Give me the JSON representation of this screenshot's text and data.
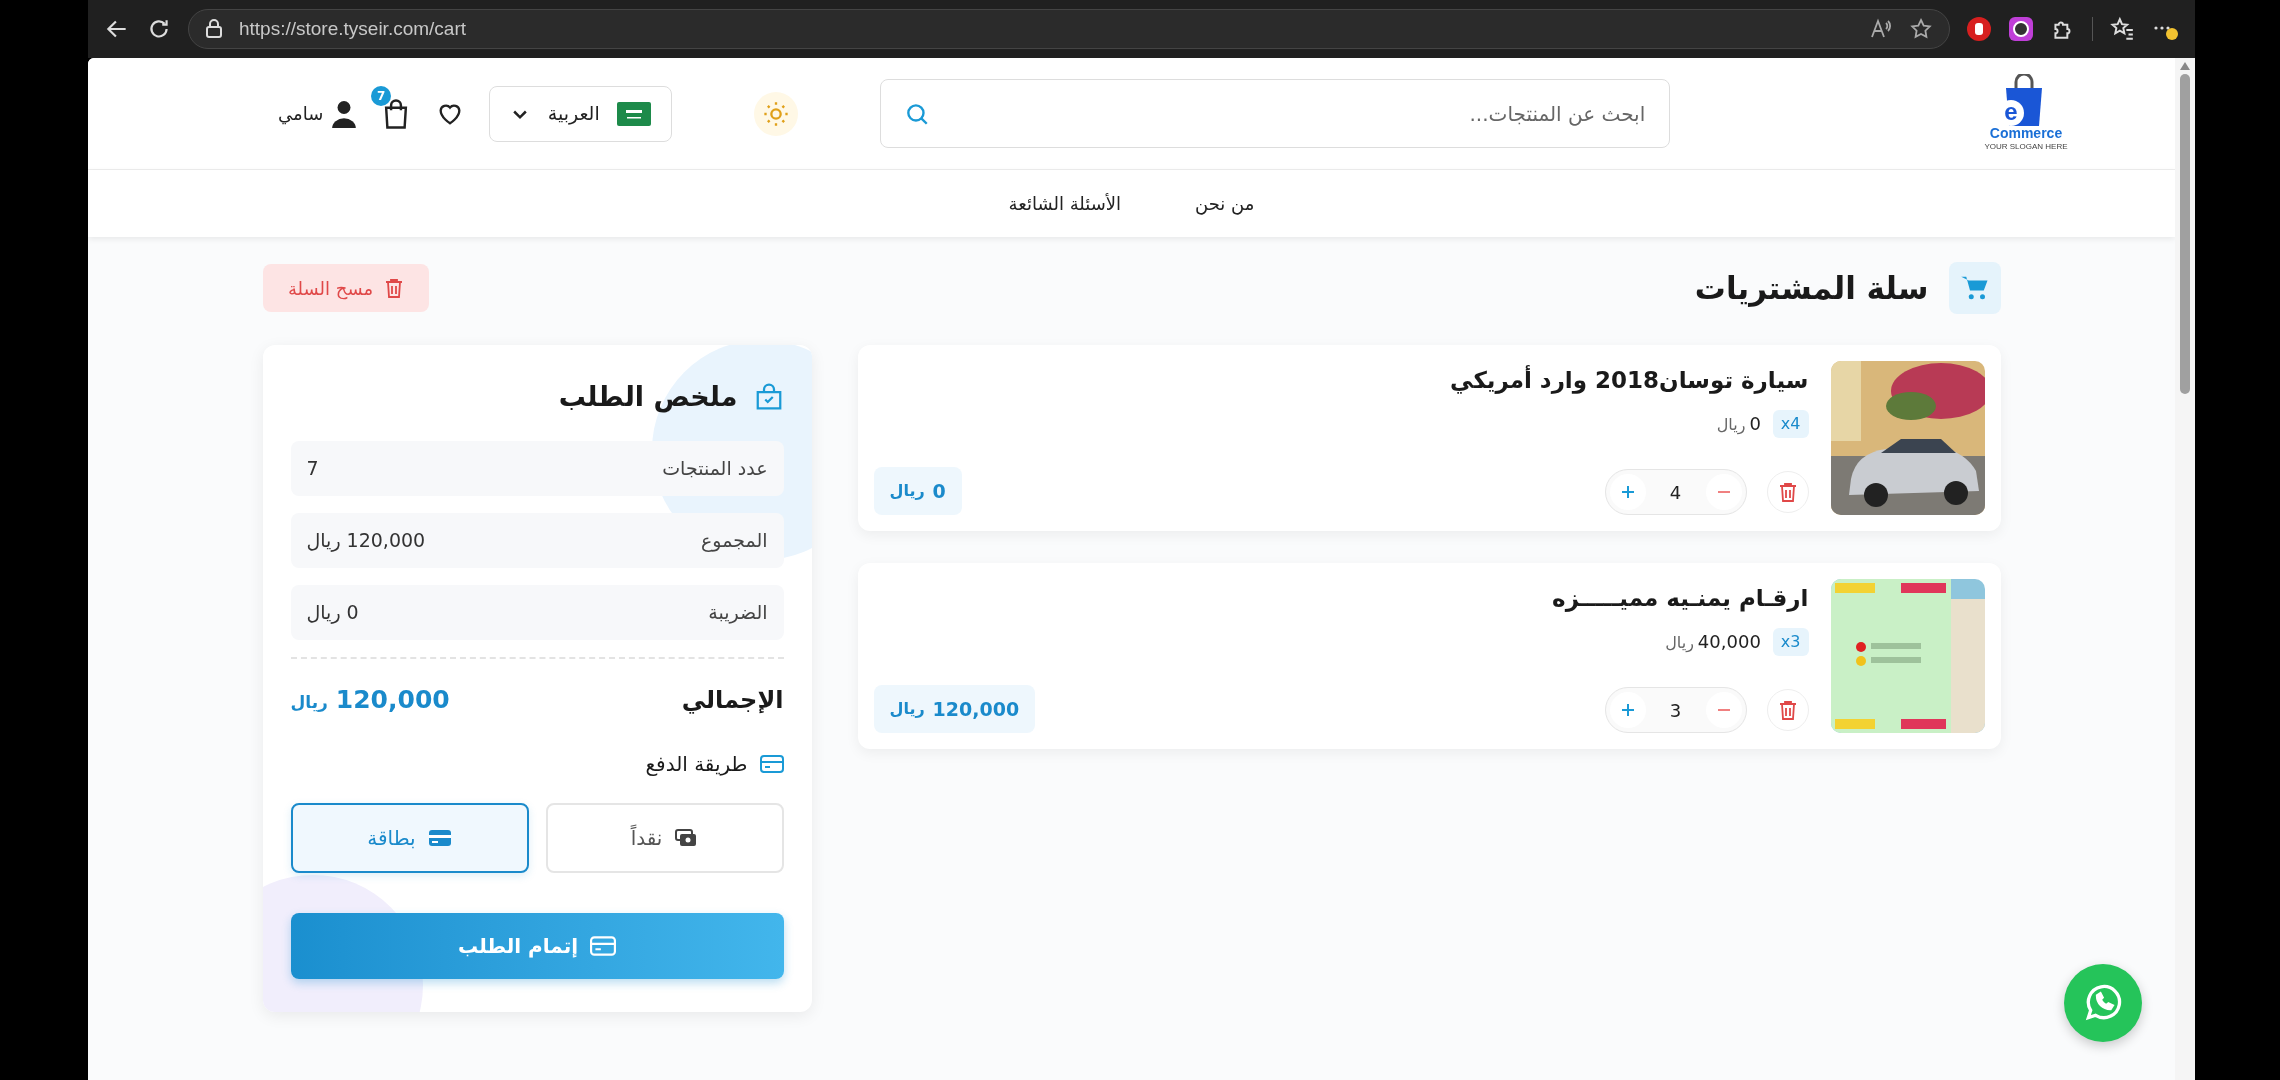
{
  "browser": {
    "url": "https://store.tyseir.com/cart"
  },
  "header": {
    "logo": {
      "mark": "e",
      "name": "Commerce",
      "slogan": "YOUR SLOGAN HERE"
    },
    "search": {
      "placeholder": "ابحث عن المنتجات..."
    },
    "language": "العربية",
    "cart_count": "7",
    "user": "سامي"
  },
  "nav": [
    {
      "label": "من نحن"
    },
    {
      "label": "الأسئلة الشائعة"
    }
  ],
  "cart": {
    "title": "سلة المشتريات",
    "clear_label": "مسح السلة",
    "items": [
      {
        "title": "سيارة توسان2018 وارد أمريكي",
        "qty_badge": "x4",
        "price": "0",
        "currency": "ريال",
        "quantity": "4",
        "line_total": "0",
        "line_currency": "ريال"
      },
      {
        "title": "ارقـام يمنـيه مميـــــزه",
        "qty_badge": "x3",
        "price": "40,000",
        "currency": "ريال",
        "quantity": "3",
        "line_total": "120,000",
        "line_currency": "ريال"
      }
    ]
  },
  "summary": {
    "title": "ملخص الطلب",
    "rows": [
      {
        "label": "عدد المنتجات",
        "value": "7"
      },
      {
        "label": "المجموع",
        "value": "120,000 ريال"
      },
      {
        "label": "الضريبة",
        "value": "0 ريال"
      }
    ],
    "total": {
      "label": "الإجمالي",
      "amount": "120,000",
      "currency": "ريال"
    },
    "payment": {
      "label": "طريقة الدفع",
      "options": [
        {
          "label": "نقداً",
          "kind": "cash",
          "selected": false
        },
        {
          "label": "بطاقة",
          "kind": "card",
          "selected": true
        }
      ]
    },
    "submit": "إتمام الطلب"
  }
}
